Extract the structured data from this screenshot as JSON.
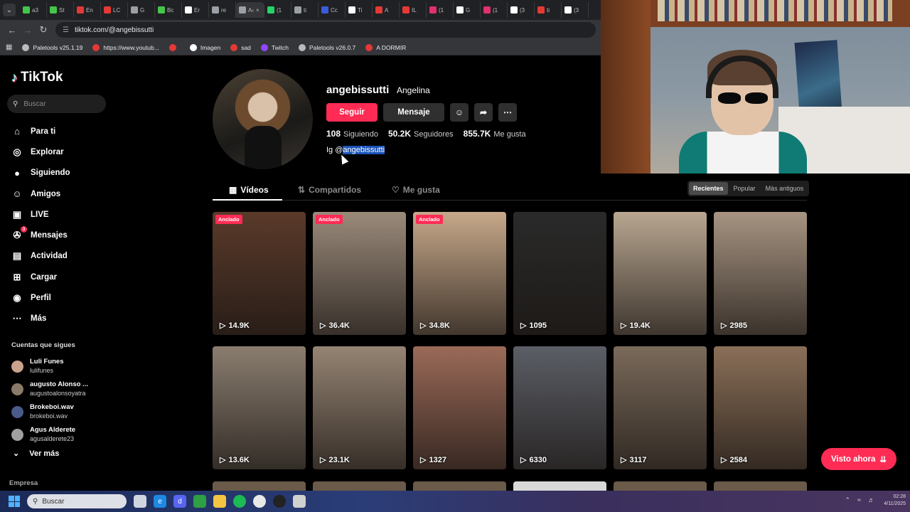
{
  "browser": {
    "tabs": [
      {
        "label": "a3",
        "color": "#45c54a"
      },
      {
        "label": "St",
        "color": "#45c54a"
      },
      {
        "label": "En",
        "color": "#e53935"
      },
      {
        "label": "LC",
        "color": "#e53935"
      },
      {
        "label": "G",
        "color": "#9aa0a6"
      },
      {
        "label": "Bc",
        "color": "#45c54a"
      },
      {
        "label": "Er",
        "color": "#ffffff"
      },
      {
        "label": "re",
        "color": "#9aa0a6"
      },
      {
        "label": "A‹",
        "color": "#9aa0a6",
        "active": true
      },
      {
        "label": "(1",
        "color": "#25d366"
      },
      {
        "label": "ti",
        "color": "#9aa0a6"
      },
      {
        "label": "Cc",
        "color": "#3b5bdb"
      },
      {
        "label": "Ti",
        "color": "#ffffff"
      },
      {
        "label": "A",
        "color": "#e53935"
      },
      {
        "label": "IL",
        "color": "#e53935"
      },
      {
        "label": "(1",
        "color": "#e1306c"
      },
      {
        "label": "G",
        "color": "#ffffff"
      },
      {
        "label": "(1",
        "color": "#e1306c"
      },
      {
        "label": "(3",
        "color": "#ffffff"
      },
      {
        "label": "ti",
        "color": "#e53935"
      },
      {
        "label": "(3",
        "color": "#ffffff"
      }
    ],
    "url": "tiktok.com/@angebissutti",
    "bookmarks": [
      {
        "label": "Paletools v25.1.19",
        "color": "#bbbbbb"
      },
      {
        "label": "https://www.youtub...",
        "color": "#e53935"
      },
      {
        "label": "",
        "color": "#e53935"
      },
      {
        "label": "Imagen",
        "color": "#ffffff"
      },
      {
        "label": "sad",
        "color": "#e53935"
      },
      {
        "label": "Twitch",
        "color": "#9146ff"
      },
      {
        "label": "Paletools v26.0.7",
        "color": "#bbbbbb"
      },
      {
        "label": "A DORMIR",
        "color": "#e53935"
      }
    ]
  },
  "sidebar": {
    "logo": "TikTok",
    "search_placeholder": "Buscar",
    "nav": [
      {
        "label": "Para ti",
        "icon": "⌂",
        "icon_name": "home-icon"
      },
      {
        "label": "Explorar",
        "icon": "◎",
        "icon_name": "compass-icon"
      },
      {
        "label": "Siguiendo",
        "icon": "●",
        "icon_name": "following-avatar-icon"
      },
      {
        "label": "Amigos",
        "icon": "☺",
        "icon_name": "friends-icon"
      },
      {
        "label": "LIVE",
        "icon": "▣",
        "icon_name": "live-icon"
      },
      {
        "label": "Mensajes",
        "icon": "✇",
        "icon_name": "messages-icon",
        "badge": "3"
      },
      {
        "label": "Actividad",
        "icon": "▤",
        "icon_name": "activity-icon"
      },
      {
        "label": "Cargar",
        "icon": "⊞",
        "icon_name": "upload-icon"
      },
      {
        "label": "Perfil",
        "icon": "◉",
        "icon_name": "profile-icon"
      },
      {
        "label": "Más",
        "icon": "⋯",
        "icon_name": "more-icon"
      }
    ],
    "following_title": "Cuentas que sigues",
    "following": [
      {
        "name": "Luli Funes",
        "user": "lulifunes",
        "color": "#c9a38c"
      },
      {
        "name": "augusto Alonso ...",
        "user": "augustoalonsoyatra",
        "color": "#8a7a6a"
      },
      {
        "name": "Brokeboi.wav",
        "user": "brokeboi.wav",
        "color": "#4a5a8a"
      },
      {
        "name": "Agus Alderete",
        "user": "agusalderete23",
        "color": "#a0a0a0"
      }
    ],
    "see_more": "Ver más",
    "footer": "Empresa"
  },
  "profile": {
    "username": "angebissutti",
    "nickname": "Angelina",
    "follow_label": "Seguir",
    "message_label": "Mensaje",
    "stats": [
      {
        "value": "108",
        "label": "Siguiendo"
      },
      {
        "value": "50.2K",
        "label": "Seguidores"
      },
      {
        "value": "855.7K",
        "label": "Me gusta"
      }
    ],
    "bio_prefix": "Ig @",
    "bio_highlight": "angebissutti",
    "tabs": [
      "Vídeos",
      "Compartidos",
      "Me gusta"
    ],
    "sort": [
      "Recientes",
      "Popular",
      "Más antiguos"
    ]
  },
  "videos": {
    "pinned_label": "Anclado",
    "items": [
      {
        "views": "14.9K",
        "pinned": true,
        "bg": "#5a3a2a"
      },
      {
        "views": "36.4K",
        "pinned": true,
        "bg": "#9a8a7a"
      },
      {
        "views": "34.8K",
        "pinned": true,
        "bg": "#c7a88a"
      },
      {
        "views": "1095",
        "pinned": false,
        "bg": "#2a2a2a"
      },
      {
        "views": "19.4K",
        "pinned": false,
        "bg": "#b8a690"
      },
      {
        "views": "2985",
        "pinned": false,
        "bg": "#a79482"
      },
      {
        "views": "13.6K",
        "pinned": false,
        "bg": "#8a7d6f"
      },
      {
        "views": "23.1K",
        "pinned": false,
        "bg": "#958473"
      },
      {
        "views": "1327",
        "pinned": false,
        "bg": "#9b6a58"
      },
      {
        "views": "6330",
        "pinned": false,
        "bg": "#5b5e66"
      },
      {
        "views": "3117",
        "pinned": false,
        "bg": "#7a6a5a"
      },
      {
        "views": "2584",
        "pinned": false,
        "bg": "#8a6f58"
      }
    ]
  },
  "watch_now": "Visto ahora",
  "taskbar": {
    "search": "Buscar",
    "time": "02:28",
    "date": "4/11/2025"
  }
}
